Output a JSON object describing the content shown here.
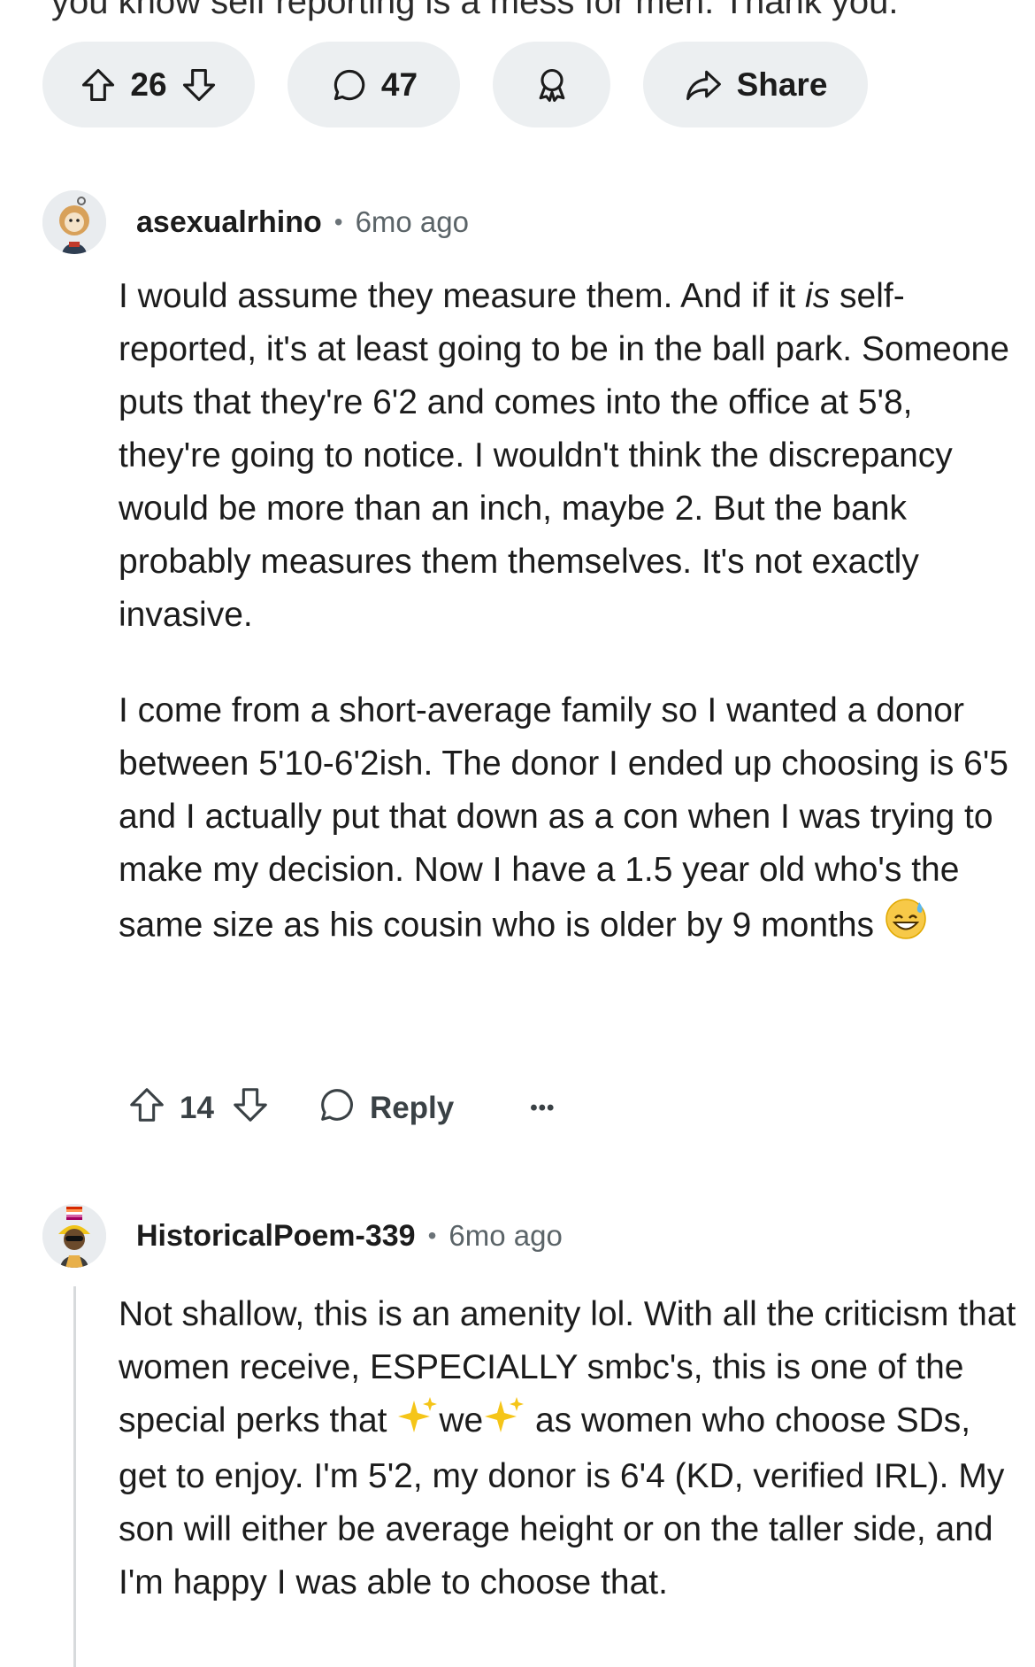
{
  "post": {
    "cut_text": "you know self reporting is a mess for men. Thank you.",
    "vote_count": "26",
    "comment_count": "47",
    "share_label": "Share"
  },
  "comments": [
    {
      "author": "asexualrhino",
      "separator": "•",
      "time": "6mo ago",
      "paragraphs": [
        "I would assume they measure them. And if it ",
        "is",
        " self-reported, it's at least going to be in the ball park. Someone puts that they're 6'2 and comes into the office at 5'8, they're going to notice. I wouldn't think the discrepancy would be more than an inch, maybe 2. But the bank probably measures them themselves. It's not exactly invasive.",
        "I come from a short-average family so I wanted a donor between 5'10-6'2ish. The donor I ended up choosing is 6'5 and I actually put that down as a con when I was trying to make my decision. Now I have a 1.5 year old who's the same size as his cousin who is older by 9 months"
      ],
      "emoji": "grinning-sweat-emoji",
      "votes": "14",
      "reply_label": "Reply",
      "more_label": "•••"
    },
    {
      "author": "HistoricalPoem-339",
      "separator": "•",
      "time": "6mo ago",
      "text_1": "Not shallow, this is an amenity lol. With all the criticism that women receive, ESPECIALLY smbc's, this is one of the special perks that ",
      "sparkle_word": "we",
      "text_2": " as women who choose SDs, get to enjoy. I'm 5'2, my donor is 6'4 (KD, verified IRL). My son will either be average height or on the taller side, and I'm happy I was able to choose that."
    }
  ],
  "colors": {
    "pill_bg": "#eceff1",
    "text": "#1c1c1c",
    "meta": "#5b6468",
    "thread_line": "#d7dadc"
  }
}
